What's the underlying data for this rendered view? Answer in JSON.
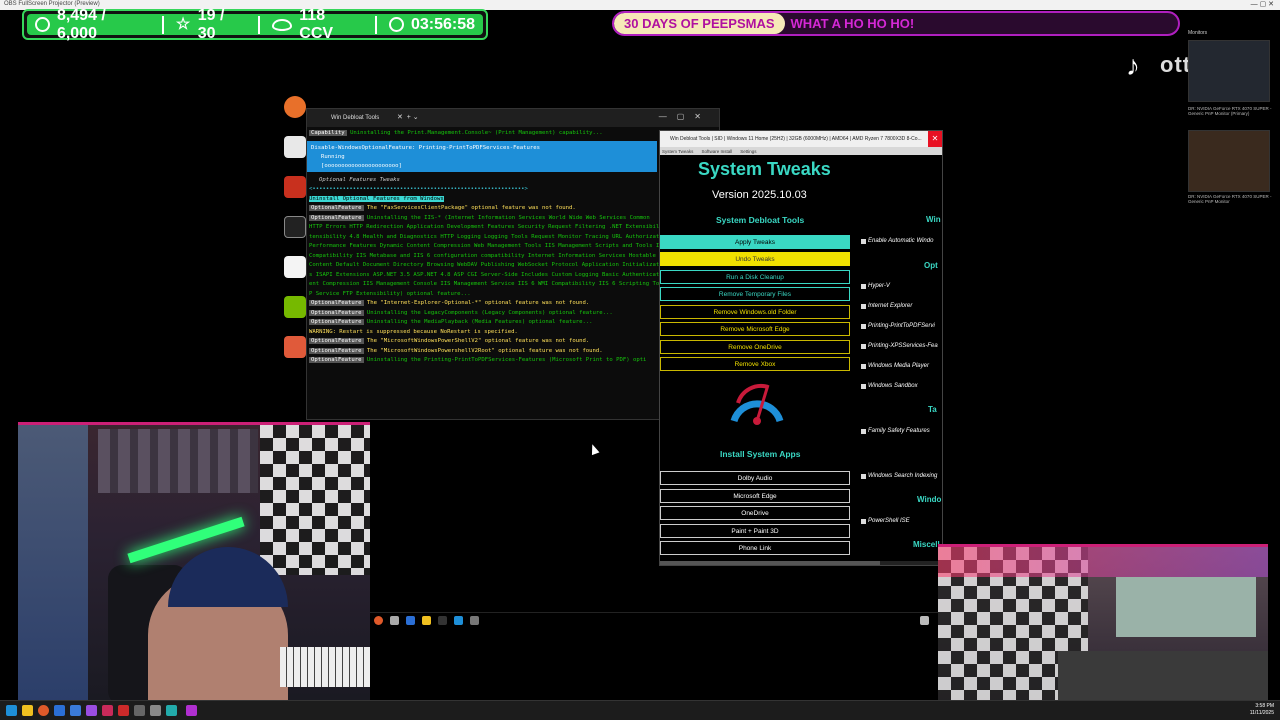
{
  "browser": {
    "tab_title": "OBS FullScreen Projector (Preview)",
    "window_controls": "—  ▢  ✕"
  },
  "stats": {
    "followers": "8,494 / 6,000",
    "goal": "19 / 30",
    "viewers": "118 CCV",
    "uptime": "03:56:58"
  },
  "banner": {
    "part1": "30 DAYS OF PEEPSMAS",
    "part2": "WHAT A HO HO HO!"
  },
  "branding": {
    "handle": "ottrmsp"
  },
  "monitors": {
    "title": "Monitors",
    "cap1": "DR: NVIDIA GeForce RTX 4070 SUPER - Generic PnP Monitor (Primary)",
    "cap2": "DR: NVIDIA GeForce RTX 4070 SUPER - Generic PnP Monitor"
  },
  "terminal": {
    "title": "Win Debloat Tools",
    "lines": [
      {
        "tag": "Capability",
        "text": "Uninstalling the Print.Management.Console~ (Print Management) capability...",
        "cls": "grn"
      },
      {
        "tag": "",
        "text": "",
        "cls": ""
      }
    ],
    "progress_title": "Disable-WindowsOptionalFeature: Printing-PrintToPDFServices-Features",
    "progress_status": "Running",
    "progress_bar": "[oooooooooooooooooooooo]",
    "section": "Optional Features Tweaks",
    "dots": "<•••••••••••••••••••••••••••••••••••••••••••••••••••••••••••••••>",
    "header": "Uninstall Optional Features from Windows",
    "rows": [
      {
        "tag": "OptionalFeature",
        "text": "The \"FaxServicesClientPackage\" optional feature was not found.",
        "cls": "ylw"
      },
      {
        "tag": "OptionalFeature",
        "text": "Uninstalling the IIS-* (Internet Information Services World Wide Web Services Common",
        "cls": "grn"
      },
      {
        "tag": "",
        "text": "HTTP Errors HTTP Redirection Application Development Features Security Request Filtering .NET Extensibil",
        "cls": "grn"
      },
      {
        "tag": "",
        "text": "tensibility 4.8 Health and Diagnostics HTTP Logging Logging Tools Request Monitor Tracing URL Authorizat",
        "cls": "grn"
      },
      {
        "tag": "",
        "text": "Performance Features Dynamic Content Compression Web Management Tools IIS Management Scripts and Tools II",
        "cls": "grn"
      },
      {
        "tag": "",
        "text": "Compatibility IIS Metabase and IIS 6 configuration compatibility Internet Information Services Hostable W",
        "cls": "grn"
      },
      {
        "tag": "",
        "text": "Content Default Document Directory Browsing WebDAV Publishing WebSocket Protocol Application Initializat",
        "cls": "grn"
      },
      {
        "tag": "",
        "text": "s ISAPI Extensions ASP.NET 3.5 ASP.NET 4.8 ASP CGI Server-Side Includes Custom Logging Basic Authenticat",
        "cls": "grn"
      },
      {
        "tag": "",
        "text": "ent Compression IIS Management Console IIS Management Service IIS 6 WMI Compatibility IIS 6 Scripting Tool",
        "cls": "grn"
      },
      {
        "tag": "",
        "text": "P Service FTP Extensibility) optional feature...",
        "cls": "grn"
      },
      {
        "tag": "OptionalFeature",
        "text": "The \"Internet-Explorer-Optional-*\" optional feature was not found.",
        "cls": "ylw"
      },
      {
        "tag": "OptionalFeature",
        "text": "Uninstalling the LegacyComponents (Legacy Components) optional feature...",
        "cls": "grn"
      },
      {
        "tag": "OptionalFeature",
        "text": "Uninstalling the MediaPlayback (Media Features) optional feature...",
        "cls": "grn"
      },
      {
        "tag": "",
        "text": "WARNING: Restart is suppressed because NoRestart is specified.",
        "cls": "ylw"
      },
      {
        "tag": "OptionalFeature",
        "text": "The \"MicrosoftWindowsPowerShellV2\" optional feature was not found.",
        "cls": "ylw"
      },
      {
        "tag": "OptionalFeature",
        "text": "The \"MicrosoftWindowsPowershellV2Root\" optional feature was not found.",
        "cls": "ylw"
      },
      {
        "tag": "OptionalFeature",
        "text": "Uninstalling the Printing-PrintToPDFServices-Features (Microsoft Print to PDF) opti",
        "cls": "grn"
      }
    ]
  },
  "tweaks": {
    "window_title": "Win Debloat Tools | SID | Windows 11 Home (25H2) | 32GB (6000MHz) | AMD64 | AMD Ryzen 7 7800X3D 8-Co...",
    "tabs": [
      "System Tweaks",
      "Software Install",
      "Settings"
    ],
    "title": "System Tweaks",
    "version": "Version 2025.10.03",
    "section_debloat": "System Debloat Tools",
    "buttons": {
      "apply": "Apply Tweaks",
      "undo": "Undo Tweaks",
      "disk": "Run a Disk Cleanup",
      "temp": "Remove Temporary Files",
      "winold": "Remove Windows.old Folder",
      "edge": "Remove Microsoft Edge",
      "onedrive": "Remove OneDrive",
      "xbox": "Remove Xbox"
    },
    "section_install": "Install System Apps",
    "apps": {
      "dolby": "Dolby Audio",
      "edge": "Microsoft Edge",
      "onedrive": "OneDrive",
      "paint": "Paint + Paint 3D",
      "phone": "Phone Link"
    },
    "right": {
      "h_win": "Win",
      "auto": "Enable Automatic Windo",
      "h_opt": "Opt",
      "hyperv": "Hyper-V",
      "ie": "Internet Explorer",
      "pdf": "Printing-PrintToPDFServi",
      "xps": "Printing-XPSServices-Fea",
      "wmp": "Windows Media Player",
      "sandbox": "Windows Sandbox",
      "h_ta": "Ta",
      "family": "Family Safety Features",
      "search": "Windows Search Indexing",
      "h_windo": "Windo",
      "ise": "PowerShell ISE",
      "h_misc": "Miscell"
    }
  },
  "clock": {
    "time": "3:58 PM",
    "date": "11/11/2025"
  }
}
